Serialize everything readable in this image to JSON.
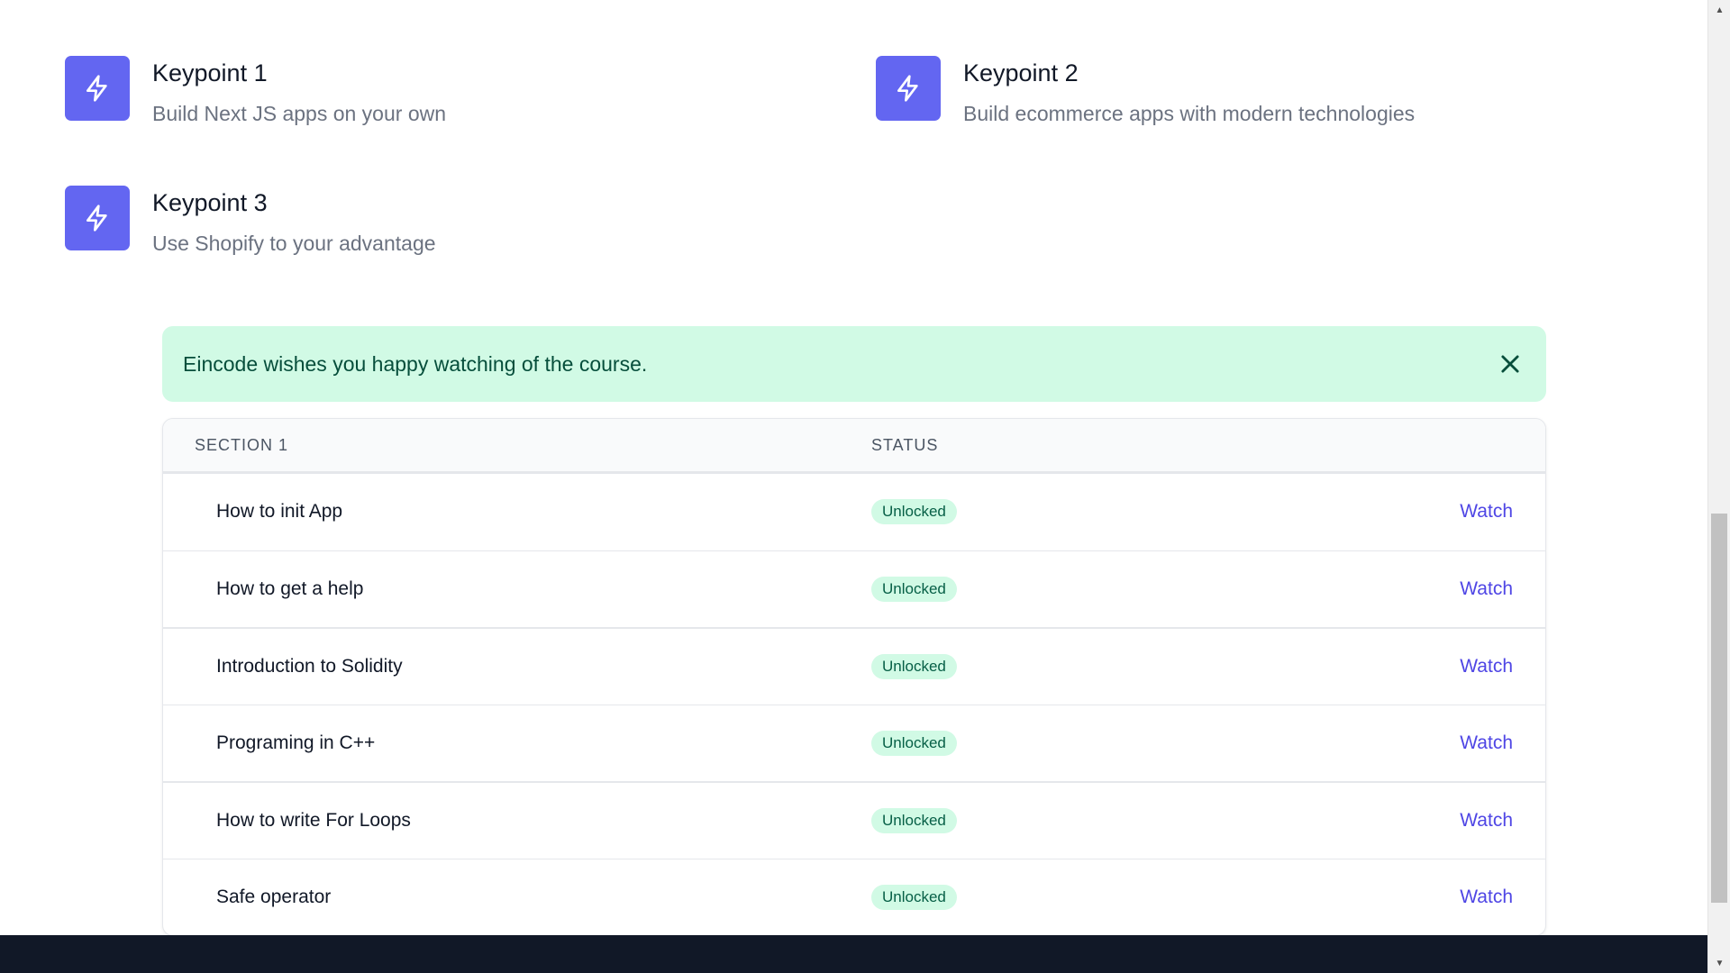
{
  "keypoints": [
    {
      "title": "Keypoint 1",
      "desc": "Build Next JS apps on your own"
    },
    {
      "title": "Keypoint 2",
      "desc": "Build ecommerce apps with modern technologies"
    },
    {
      "title": "Keypoint 3",
      "desc": "Use Shopify to your advantage"
    }
  ],
  "alert": {
    "message": "Eincode wishes you happy watching of the course."
  },
  "table": {
    "headers": {
      "section": "SECTION 1",
      "status": "STATUS"
    },
    "rows": [
      {
        "title": "How to init App",
        "status": "Unlocked",
        "action": "Watch"
      },
      {
        "title": "How to get a help",
        "status": "Unlocked",
        "action": "Watch"
      },
      {
        "title": "Introduction to Solidity",
        "status": "Unlocked",
        "action": "Watch"
      },
      {
        "title": "Programing in C++",
        "status": "Unlocked",
        "action": "Watch"
      },
      {
        "title": "How to write For Loops",
        "status": "Unlocked",
        "action": "Watch"
      },
      {
        "title": "Safe operator",
        "status": "Unlocked",
        "action": "Watch"
      }
    ]
  },
  "icons": {
    "keypoint": "lightning-bolt-icon",
    "close": "close-icon"
  },
  "colors": {
    "accent": "#6366f1",
    "alert_bg": "#d1fae5",
    "badge_bg": "#d1fae5",
    "link": "#4f46e5",
    "footer": "#111827"
  }
}
